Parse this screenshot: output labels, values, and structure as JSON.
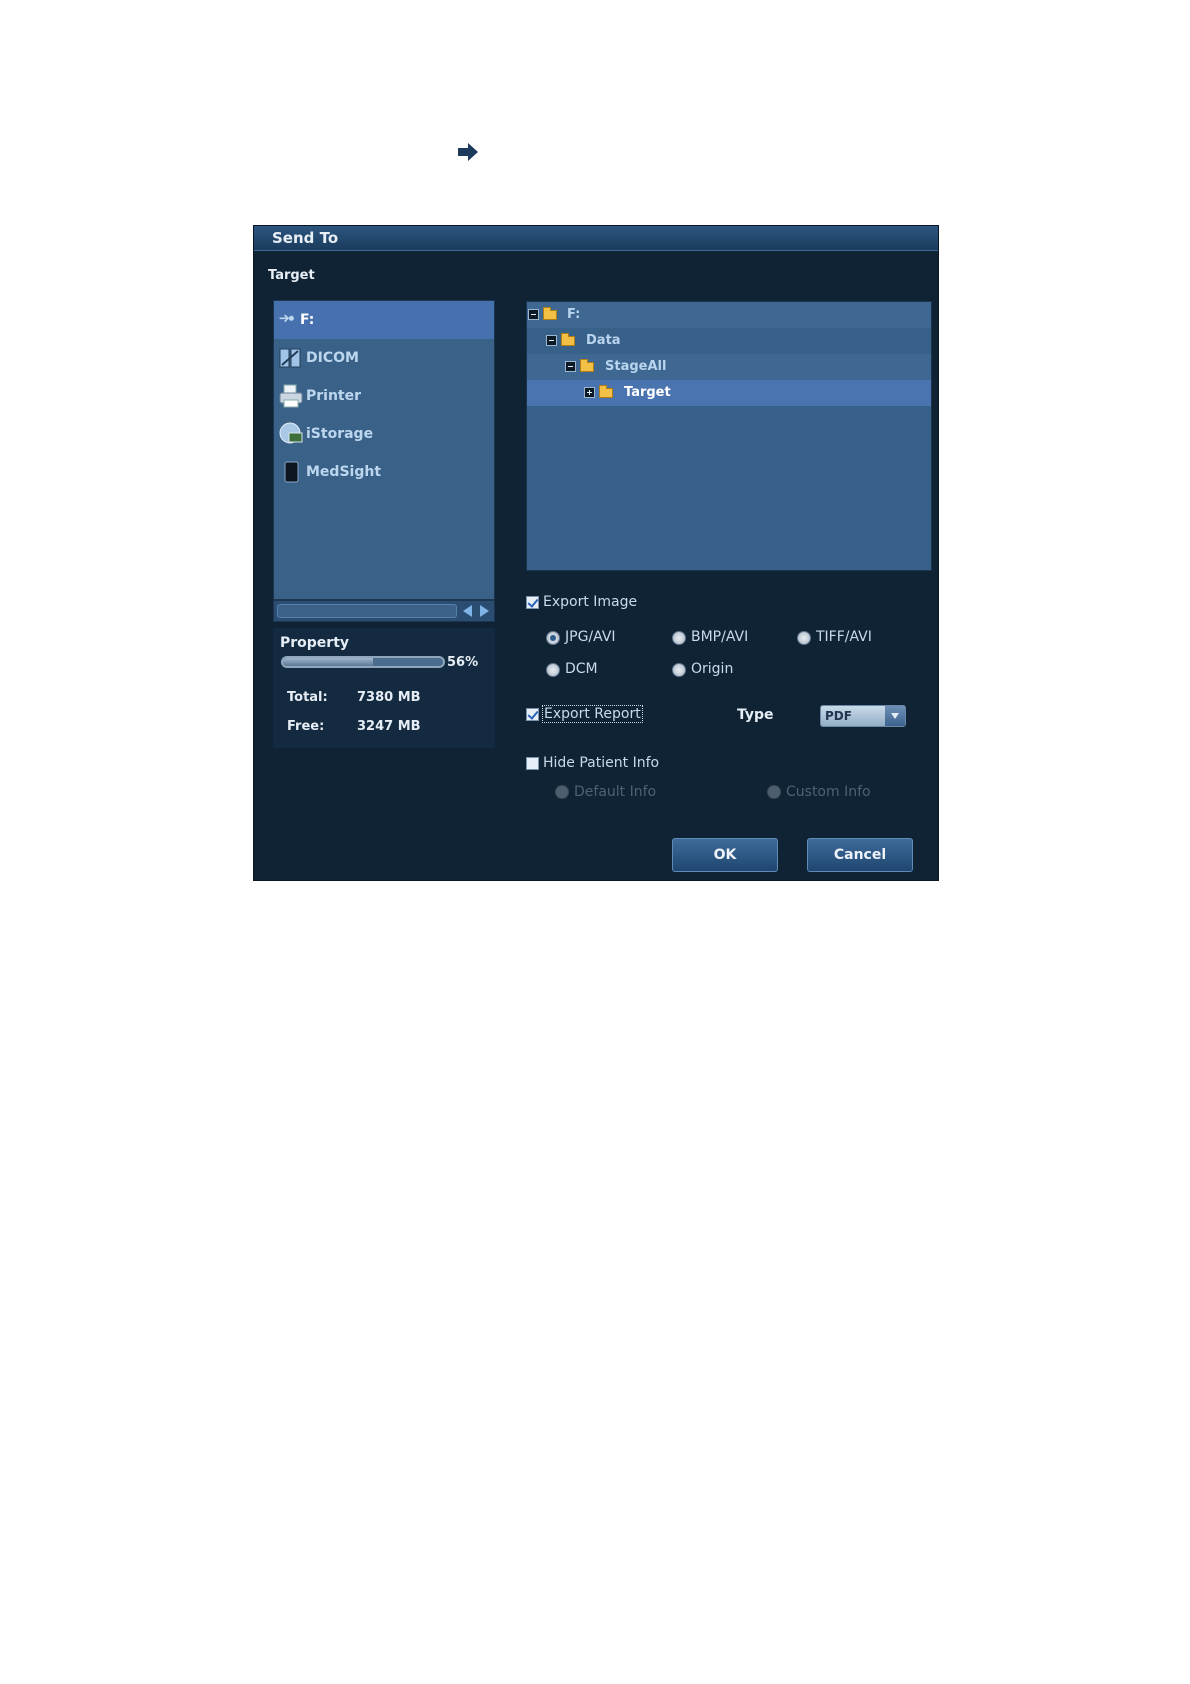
{
  "dialog": {
    "title": "Send To",
    "target_label": "Target"
  },
  "targets": [
    {
      "label": "F:",
      "icon": "usb-drive-icon",
      "selected": true
    },
    {
      "label": "DICOM",
      "icon": "dicom-icon"
    },
    {
      "label": "Printer",
      "icon": "printer-icon"
    },
    {
      "label": "iStorage",
      "icon": "istorage-icon"
    },
    {
      "label": "MedSight",
      "icon": "tablet-icon"
    }
  ],
  "property": {
    "heading": "Property",
    "usage_percent": 56,
    "usage_label": "56%",
    "total_label": "Total:",
    "total_value": "7380 MB",
    "free_label": "Free:",
    "free_value": "3247 MB"
  },
  "tree": [
    {
      "label": "F:",
      "level": 0,
      "expanded": true
    },
    {
      "label": "Data",
      "level": 1,
      "expanded": true
    },
    {
      "label": "StageAll",
      "level": 2,
      "expanded": true
    },
    {
      "label": "Target",
      "level": 3,
      "expanded": false,
      "selected": true
    }
  ],
  "export_image": {
    "label": "Export Image",
    "checked": true,
    "formats": [
      "JPG/AVI",
      "BMP/AVI",
      "TIFF/AVI",
      "DCM",
      "Origin"
    ],
    "selected": "JPG/AVI"
  },
  "export_report": {
    "label": "Export Report",
    "checked": true,
    "type_label": "Type",
    "type_value": "PDF"
  },
  "hide_patient_info": {
    "label": "Hide Patient Info",
    "checked": false,
    "options": [
      "Default Info",
      "Custom Info"
    ]
  },
  "buttons": {
    "ok": "OK",
    "cancel": "Cancel"
  }
}
